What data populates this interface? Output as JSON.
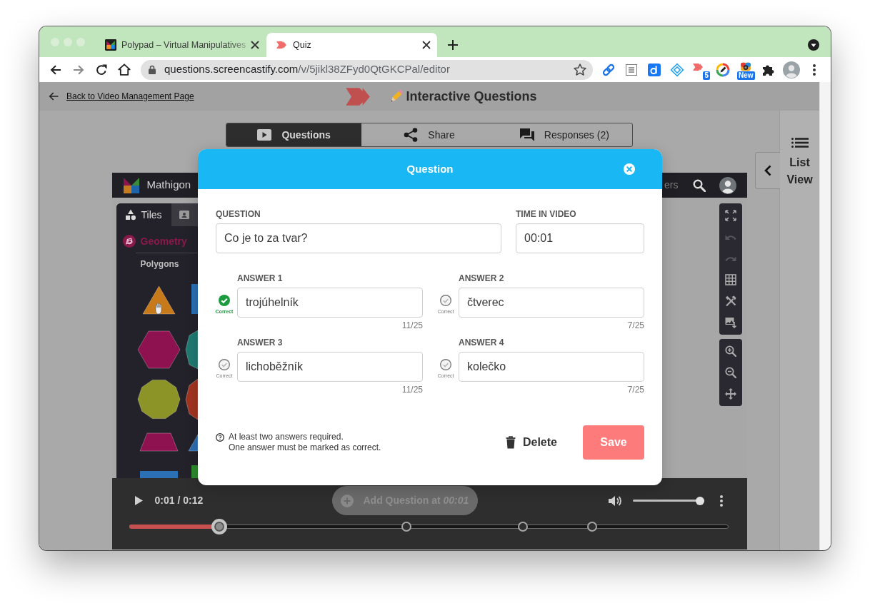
{
  "browser": {
    "tabs": [
      {
        "title": "Polypad – Virtual Manipulatives",
        "selected": false
      },
      {
        "title": "Quiz",
        "selected": true
      }
    ],
    "address": {
      "host": "questions.screencastify.com",
      "path": "/v/5jikl38ZFyd0QtGKCPal/editor"
    },
    "toolbar_badges": [
      "5",
      "New"
    ]
  },
  "page": {
    "back_link": "Back to Video Management Page",
    "title": "Interactive Questions",
    "view_tabs": [
      {
        "label": "Questions",
        "selected": true
      },
      {
        "label": "Share",
        "selected": false
      },
      {
        "label": "Responses (2)",
        "selected": false
      }
    ],
    "side_panel": {
      "label": "List View"
    }
  },
  "video": {
    "app_name": "Mathigon",
    "header_link": "ers",
    "panel_tabs": [
      {
        "label": "Tiles",
        "selected": true
      },
      {
        "selected": false
      }
    ],
    "category": "Geometry",
    "section": "Polygons",
    "canvas_tools": [
      {
        "disabled": false
      },
      {
        "disabled": true
      },
      {
        "disabled": true
      },
      {
        "disabled": false
      },
      {
        "disabled": false
      },
      {
        "disabled": false
      }
    ],
    "zoom_tools": [
      {
        "disabled": false
      },
      {
        "disabled": false
      },
      {
        "disabled": false
      }
    ],
    "player": {
      "time": "0:01 / 0:12",
      "add_question": {
        "label": "Add Question at *00:01*",
        "disabled": true
      },
      "volume": {
        "level": 0.94
      },
      "progress": {
        "level": 0.151
      },
      "markers": [
        {
          "level": 0.4625
        },
        {
          "level": 0.657
        },
        {
          "level": 0.7735
        }
      ]
    }
  },
  "dialog": {
    "title": "Question",
    "question": {
      "label": "QUESTION",
      "value": "Co je to za tvar?"
    },
    "time": {
      "label": "TIME IN VIDEO",
      "value": "00:01"
    },
    "answers": [
      {
        "label": "ANSWER 1",
        "value": "trojúhelník",
        "count": "11/25",
        "correct": true,
        "correct_label": "Correct"
      },
      {
        "label": "ANSWER 2",
        "value": "čtverec",
        "count": "7/25",
        "correct": false,
        "correct_label": "Correct"
      },
      {
        "label": "ANSWER 3",
        "value": "lichoběžník",
        "count": "11/25",
        "correct": false,
        "correct_label": "Correct"
      },
      {
        "label": "ANSWER 4",
        "value": "kolečko",
        "count": "7/25",
        "correct": false,
        "correct_label": "Correct"
      }
    ],
    "hints": [
      "At least two answers required.",
      "One answer must be marked as correct."
    ],
    "delete_label": "Delete",
    "save_label": "Save"
  }
}
